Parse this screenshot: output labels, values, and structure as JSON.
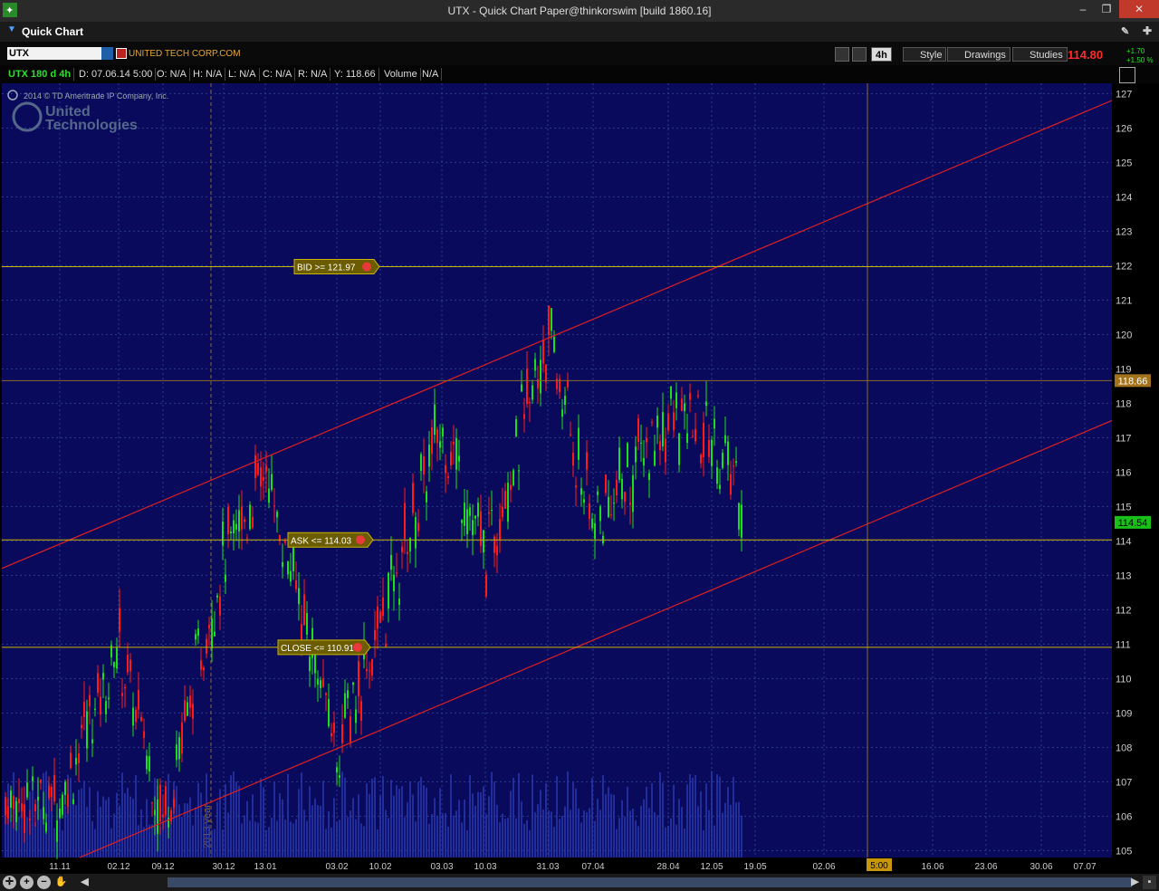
{
  "window": {
    "title": "UTX - Quick Chart Paper@thinkorswim [build 1860.16]"
  },
  "panel": {
    "title": "Quick Chart"
  },
  "symbol": {
    "value": "UTX",
    "company": "UNITED TECH CORP.COM"
  },
  "toolbar": {
    "period": "4h",
    "style": "Style",
    "drawings": "Drawings",
    "studies": "Studies",
    "last_price": "114.80",
    "change_abs": "+1.70",
    "change_pct": "+1.50 %"
  },
  "infobar": {
    "label": "UTX 180 d 4h",
    "date": "D: 07.06.14 5:00",
    "open": "O: N/A",
    "high": "H: N/A",
    "low": "L: N/A",
    "close": "C: N/A",
    "range": "R: N/A",
    "y": "Y: 118.66",
    "volume_label": "Volume",
    "volume_value": "N/A"
  },
  "copyright": "2014 © TD Ameritrade IP Company, Inc.",
  "logo": {
    "line1": "United",
    "line2": "Technologies"
  },
  "chart_data": {
    "type": "candlestick",
    "y_range": [
      104.8,
      127.3
    ],
    "y_ticks": [
      105,
      106,
      107,
      108,
      109,
      110,
      111,
      112,
      113,
      114,
      115,
      116,
      117,
      118,
      119,
      120,
      121,
      122,
      123,
      124,
      125,
      126,
      127
    ],
    "x_ticks": [
      "11.11",
      "02.12",
      "09.12",
      "30.12",
      "13.01",
      "03.02",
      "10.02",
      "03.03",
      "10.03",
      "31.03",
      "07.04",
      "28.04",
      "12.05",
      "19.05",
      "02.06",
      "16.06",
      "23.06",
      "30.06",
      "07.07"
    ],
    "year_marker": "2013 year",
    "cursor_time_label": "5:00",
    "crosshair_price": 118.66,
    "crosshair_price_label": "118.66",
    "current_price": 114.54,
    "current_price_label": "114.54",
    "alerts": [
      {
        "label": "BID >= 121.97",
        "price": 121.97
      },
      {
        "label": "ASK <= 114.03",
        "price": 114.03
      },
      {
        "label": "CLOSE <= 110.91",
        "price": 110.91
      }
    ],
    "price_path": [
      [
        "11.11",
        106.5
      ],
      [
        "02.12",
        111.0
      ],
      [
        "09.12",
        106.0
      ],
      [
        "30.12",
        113.5
      ],
      [
        "13.01",
        116.0
      ],
      [
        "03.02",
        108.0
      ],
      [
        "10.02",
        111.5
      ],
      [
        "03.03",
        117.5
      ],
      [
        "10.03",
        113.5
      ],
      [
        "31.03",
        120.0
      ],
      [
        "07.04",
        114.5
      ],
      [
        "28.04",
        117.5
      ],
      [
        "12.05",
        117.0
      ],
      [
        "19.05",
        114.5
      ]
    ],
    "volume_visible": true
  },
  "colors": {
    "background": "#0a0a5c",
    "grid": "#2b3a8a",
    "up": "#19e019",
    "down": "#ff1a1a",
    "volume": "#2a3ab0",
    "channel": "#e02020",
    "alert_line": "#c9b400",
    "crosshair": "#8a6a2a"
  }
}
